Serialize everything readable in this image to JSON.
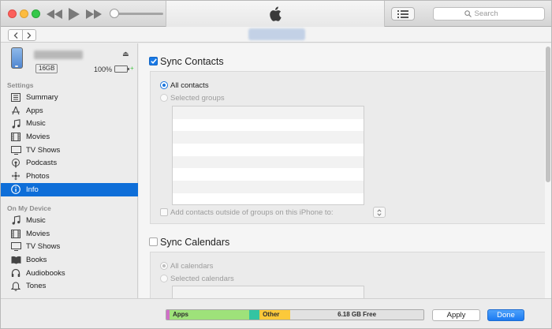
{
  "toolbar": {
    "search_placeholder": "Search"
  },
  "device": {
    "capacity": "16GB",
    "battery_percent_text": "100%",
    "battery_level": 1.0
  },
  "sidebar": {
    "settings_title": "Settings",
    "settings_items": [
      {
        "label": "Summary",
        "icon": "summary-icon"
      },
      {
        "label": "Apps",
        "icon": "apps-icon"
      },
      {
        "label": "Music",
        "icon": "music-icon"
      },
      {
        "label": "Movies",
        "icon": "movies-icon"
      },
      {
        "label": "TV Shows",
        "icon": "tv-shows-icon"
      },
      {
        "label": "Podcasts",
        "icon": "podcasts-icon"
      },
      {
        "label": "Photos",
        "icon": "photos-icon"
      },
      {
        "label": "Info",
        "icon": "info-icon",
        "selected": true
      }
    ],
    "on_device_title": "On My Device",
    "on_device_items": [
      {
        "label": "Music",
        "icon": "music-icon"
      },
      {
        "label": "Movies",
        "icon": "movies-icon"
      },
      {
        "label": "TV Shows",
        "icon": "tv-shows-icon"
      },
      {
        "label": "Books",
        "icon": "books-icon"
      },
      {
        "label": "Audiobooks",
        "icon": "audiobooks-icon"
      },
      {
        "label": "Tones",
        "icon": "tones-icon"
      }
    ]
  },
  "contacts": {
    "title": "Sync Contacts",
    "checked": true,
    "all_label": "All contacts",
    "selected_label": "Selected groups",
    "add_outside_label": "Add contacts outside of groups on this iPhone to:"
  },
  "calendars": {
    "title": "Sync Calendars",
    "checked": false,
    "all_label": "All calendars",
    "selected_label": "Selected calendars"
  },
  "capacity_bar": {
    "segments": [
      {
        "label": "",
        "color": "#d06fc8",
        "fraction": 0.012
      },
      {
        "label": "Apps",
        "color": "#9ee27a",
        "fraction": 0.31
      },
      {
        "label": "",
        "color": "#34c4a2",
        "fraction": 0.04
      },
      {
        "label": "Other",
        "color": "#fcc93a",
        "fraction": 0.12
      },
      {
        "label": "6.18 GB Free",
        "color": "#e2e2e2",
        "fraction": 0.518,
        "free": true
      }
    ]
  },
  "buttons": {
    "apply": "Apply",
    "done": "Done"
  },
  "colors": {
    "accent": "#0e6ed8",
    "battery": "#41c240"
  }
}
